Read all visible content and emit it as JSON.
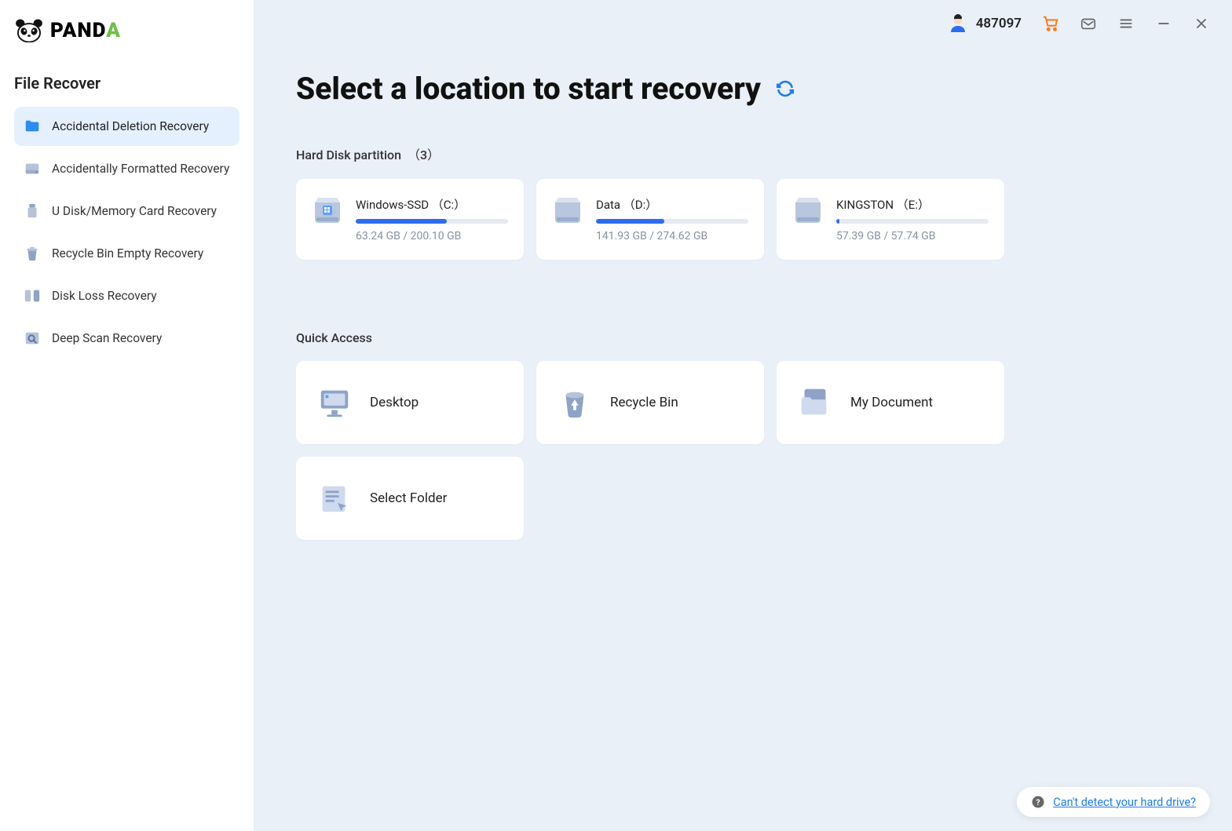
{
  "brand": "PANDA",
  "sidebar": {
    "section_title": "File Recover",
    "items": [
      {
        "label": "Accidental Deletion Recovery",
        "active": true,
        "icon": "folder"
      },
      {
        "label": "Accidentally Formatted Recovery",
        "active": false,
        "icon": "hdd"
      },
      {
        "label": "U Disk/Memory Card Recovery",
        "active": false,
        "icon": "usb"
      },
      {
        "label": "Recycle Bin Empty Recovery",
        "active": false,
        "icon": "trash"
      },
      {
        "label": "Disk Loss Recovery",
        "active": false,
        "icon": "disks"
      },
      {
        "label": "Deep Scan Recovery",
        "active": false,
        "icon": "scan"
      }
    ]
  },
  "topbar": {
    "user_id": "487097"
  },
  "page": {
    "title": "Select a location to start recovery",
    "partitions_label": "Hard Disk partition",
    "partitions_count": "（3）",
    "quick_label": "Quick Access"
  },
  "partitions": [
    {
      "name": "Windows-SSD （C:）",
      "used": "63.24 GB",
      "total": "200.10 GB",
      "percent": 60,
      "sys": true
    },
    {
      "name": "Data （D:）",
      "used": "141.93 GB",
      "total": "274.62 GB",
      "percent": 45,
      "sys": false
    },
    {
      "name": "KINGSTON （E:）",
      "used": "57.39 GB",
      "total": "57.74 GB",
      "percent": 2,
      "sys": false
    }
  ],
  "quick_access": [
    {
      "label": "Desktop",
      "icon": "desktop"
    },
    {
      "label": "Recycle Bin",
      "icon": "recyclebin"
    },
    {
      "label": "My Document",
      "icon": "folders"
    },
    {
      "label": "Select Folder",
      "icon": "selectfolder"
    }
  ],
  "help": {
    "text": "Can't detect your hard drive?"
  }
}
